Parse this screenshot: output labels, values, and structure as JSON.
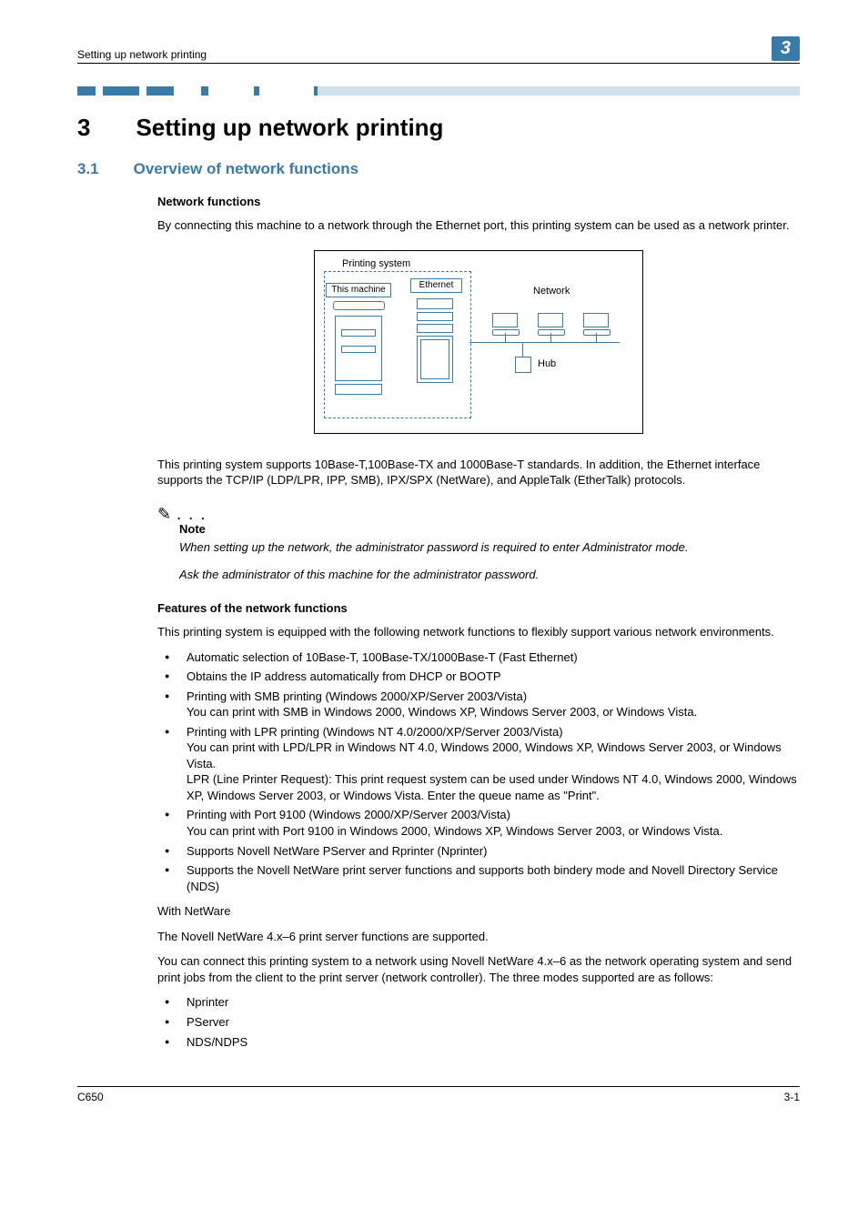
{
  "header": {
    "running_head": "Setting up network printing",
    "chapter_number_top": "3"
  },
  "chapter": {
    "number": "3",
    "title": "Setting up network printing"
  },
  "section": {
    "number": "3.1",
    "title": "Overview of network functions"
  },
  "network_functions": {
    "heading": "Network functions",
    "intro": "By connecting this machine to a network through the Ethernet port, this printing system can be used as a network printer.",
    "diagram": {
      "printing_system": "Printing system",
      "this_machine": "This machine",
      "ethernet": "Ethernet",
      "network": "Network",
      "hub": "Hub"
    },
    "standards": "This printing system supports 10Base-T,100Base-TX and 1000Base-T standards. In addition, the Ethernet interface supports the TCP/IP (LDP/LPR, IPP, SMB), IPX/SPX (NetWare), and AppleTalk (EtherTalk) protocols."
  },
  "note": {
    "label": "Note",
    "line1": "When setting up the network, the administrator password is required to enter Administrator mode.",
    "line2": "Ask the administrator of this machine for the administrator password."
  },
  "features": {
    "heading": "Features of the network functions",
    "intro": "This printing system is equipped with the following network functions to flexibly support various network environments.",
    "items": [
      "Automatic selection of 10Base-T, 100Base-TX/1000Base-T (Fast Ethernet)",
      "Obtains the IP address automatically from DHCP or BOOTP",
      "Printing with SMB printing (Windows 2000/XP/Server 2003/Vista)\nYou can print with SMB in Windows 2000, Windows XP, Windows Server 2003, or Windows Vista.",
      "Printing with LPR printing (Windows NT 4.0/2000/XP/Server 2003/Vista)\nYou can print with LPD/LPR in Windows NT 4.0, Windows 2000, Windows XP, Windows Server 2003, or Windows Vista.\nLPR (Line Printer Request): This print request system can be used under Windows NT 4.0, Windows 2000, Windows XP, Windows Server 2003, or Windows Vista. Enter the queue name as \"Print\".",
      "Printing with Port 9100 (Windows 2000/XP/Server 2003/Vista)\nYou can print with Port 9100 in Windows 2000, Windows XP, Windows Server 2003, or Windows Vista.",
      "Supports Novell NetWare PServer and Rprinter (Nprinter)",
      "Supports the Novell NetWare print server functions and supports both bindery mode and Novell Directory Service (NDS)"
    ]
  },
  "netware": {
    "heading": "With NetWare",
    "support": "The Novell NetWare 4.x–6 print server functions are supported.",
    "connect": "You can connect this printing system to a network using Novell NetWare 4.x–6 as the network operating system and send print jobs from the client to the print server (network controller). The three modes supported are as follows:",
    "modes": [
      "Nprinter",
      "PServer",
      "NDS/NDPS"
    ]
  },
  "footer": {
    "left": "C650",
    "right": "3-1"
  }
}
